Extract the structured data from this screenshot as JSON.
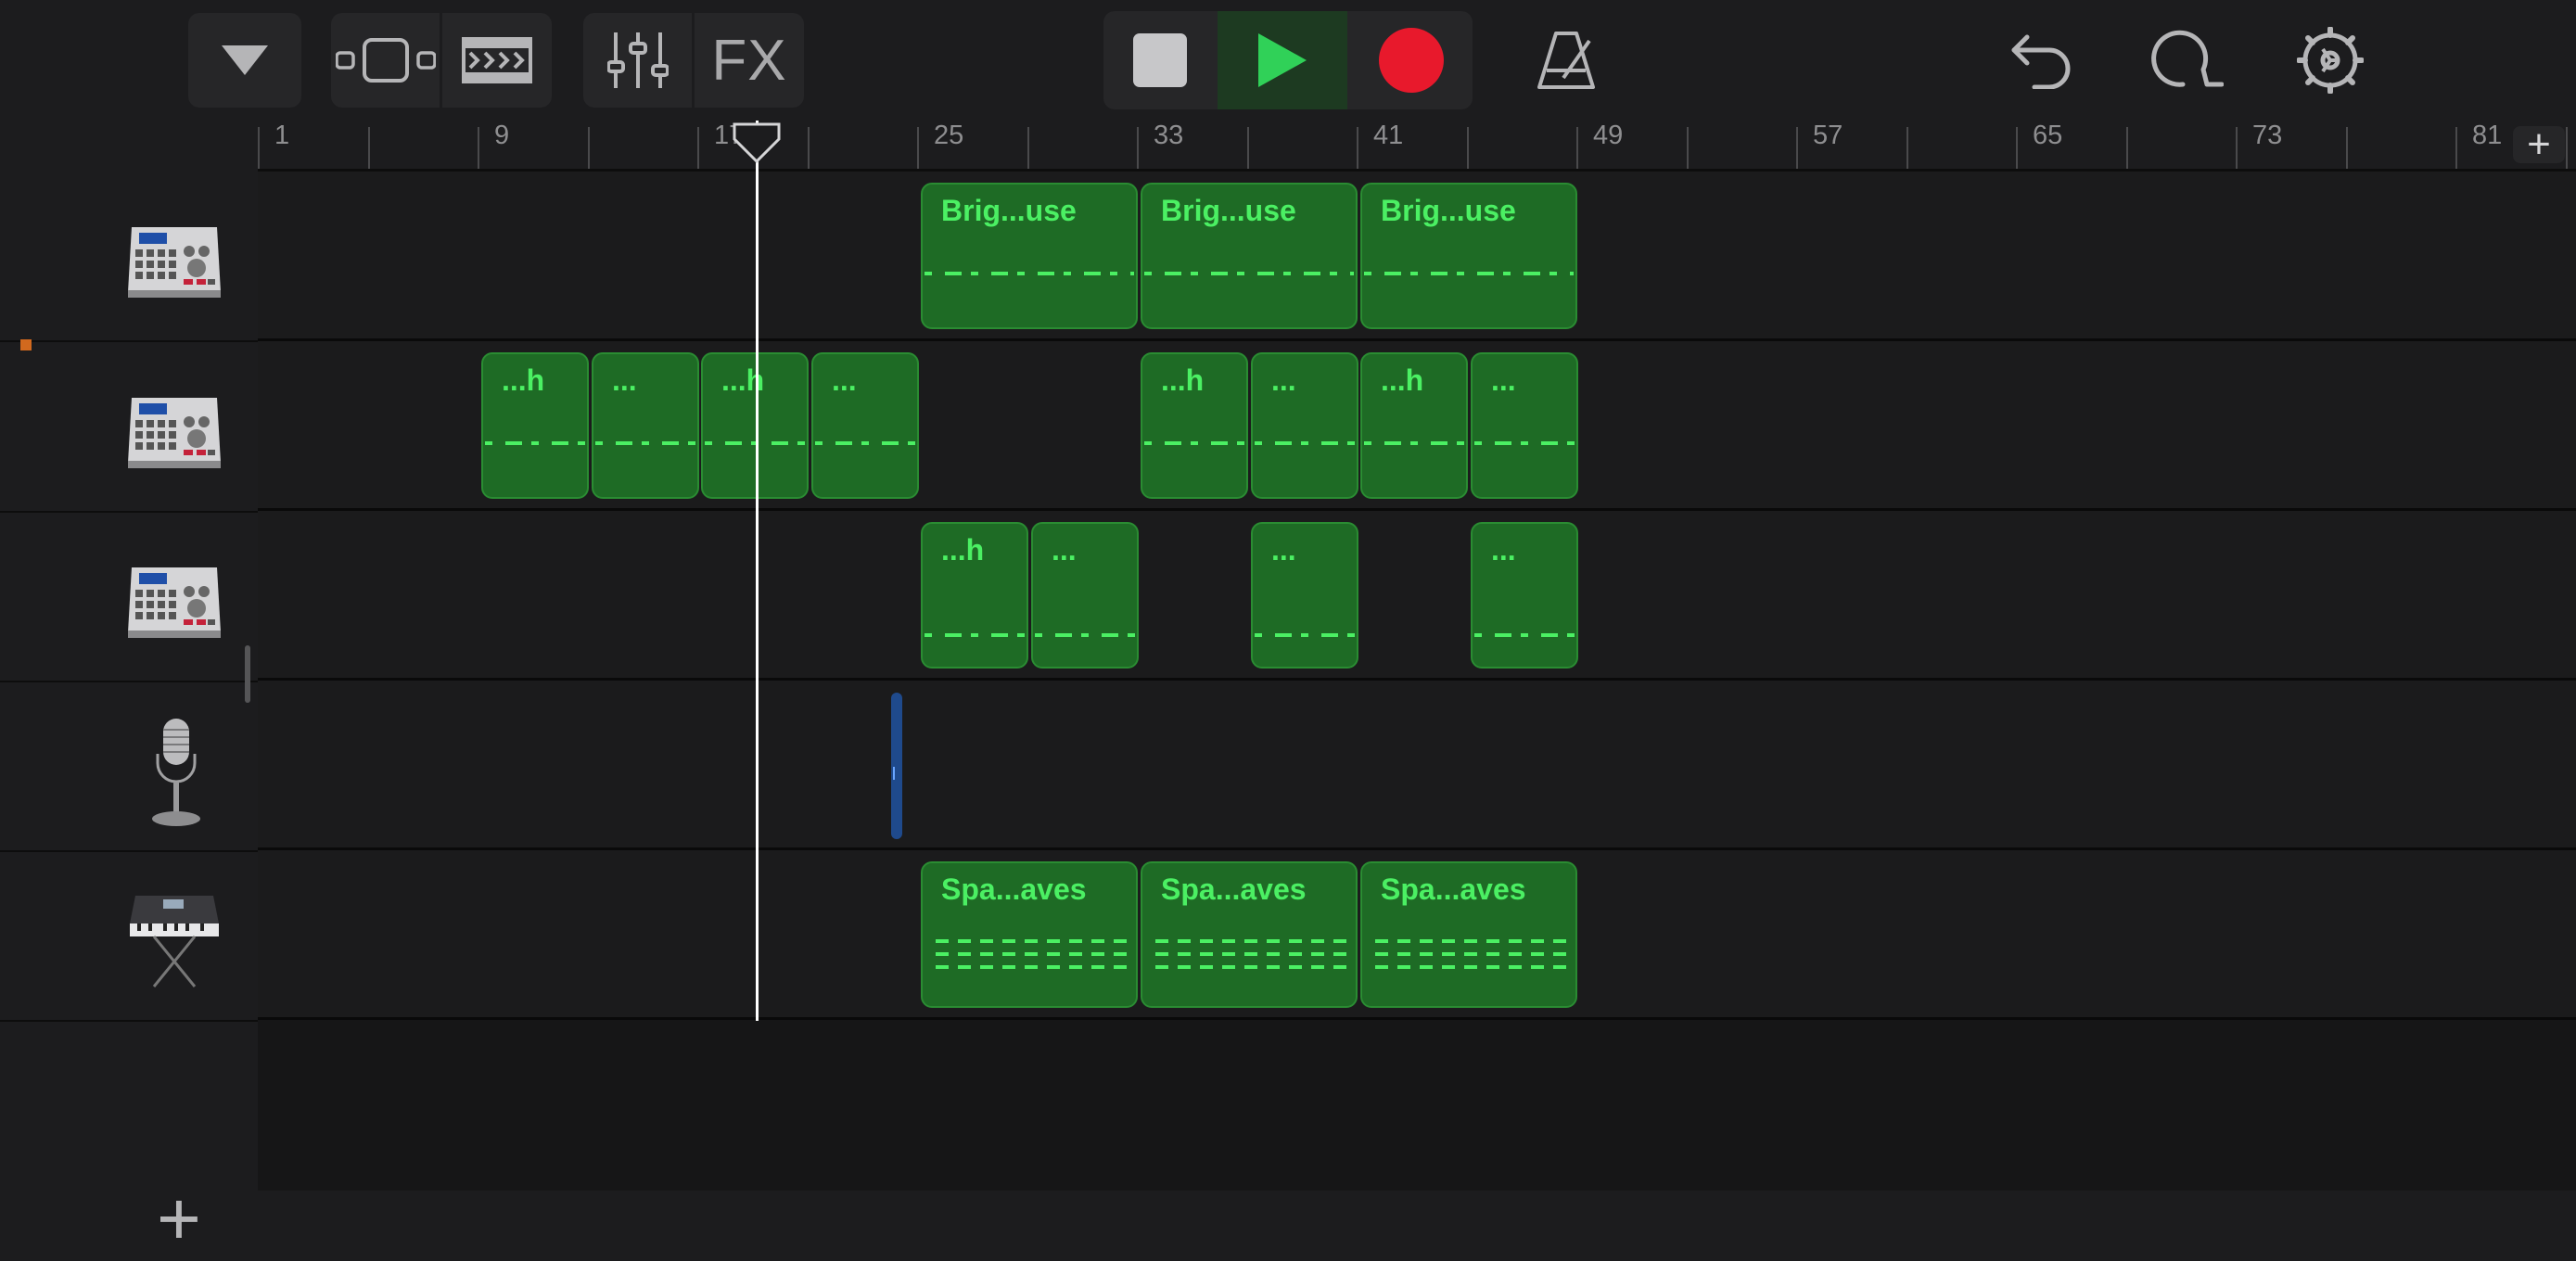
{
  "toolbar": {
    "fx_label": "FX",
    "icons": [
      "dropdown-triangle-icon",
      "tracks-view-icon",
      "live-loops-view-icon",
      "mixer-icon",
      "fx",
      "stop-icon",
      "play-icon",
      "record-icon",
      "metronome-icon",
      "undo-icon",
      "loop-browser-icon",
      "settings-icon"
    ]
  },
  "ruler": {
    "bar_numbers": [
      "1",
      "9",
      "17",
      "25",
      "33",
      "41",
      "49",
      "57",
      "65",
      "73",
      "81"
    ],
    "add_section_label": "+"
  },
  "tracks": [
    {
      "instrument": "drum-machine",
      "regions": [
        {
          "label": "Brig...use"
        },
        {
          "label": "Brig...use"
        },
        {
          "label": "Brig...use"
        }
      ]
    },
    {
      "instrument": "drum-machine",
      "regions": [
        {
          "label": "...h"
        },
        {
          "label": "..."
        },
        {
          "label": "...h"
        },
        {
          "label": "..."
        },
        {
          "label": "...h"
        },
        {
          "label": "..."
        },
        {
          "label": "...h"
        },
        {
          "label": "..."
        }
      ]
    },
    {
      "instrument": "drum-machine",
      "regions": [
        {
          "label": "...h"
        },
        {
          "label": "..."
        },
        {
          "label": "..."
        },
        {
          "label": "..."
        }
      ]
    },
    {
      "instrument": "microphone",
      "regions": []
    },
    {
      "instrument": "synthesizer",
      "regions": [
        {
          "label": "Spa...aves"
        },
        {
          "label": "Spa...aves"
        },
        {
          "label": "Spa...aves"
        }
      ]
    }
  ],
  "add_track_label": "+",
  "colors": {
    "region_fill": "#1e6b25",
    "region_text": "#4bf063",
    "record": "#e8192c",
    "play": "#30d158",
    "background": "#1c1c1e"
  }
}
